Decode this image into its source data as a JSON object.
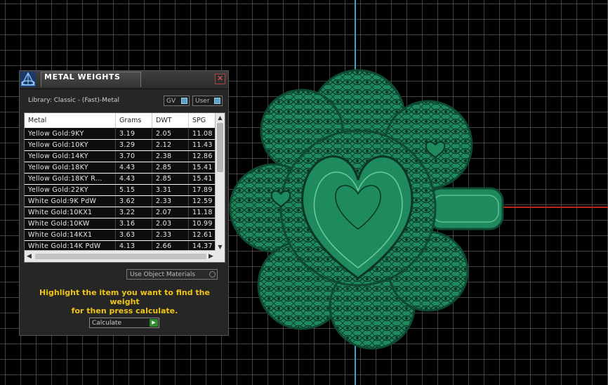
{
  "panel": {
    "title": "METAL WEIGHTS",
    "close_glyph": "✕",
    "library": "Library: Classic - (Fast)-Metal",
    "gv_label": "GV",
    "user_label": "User",
    "columns": [
      "Metal",
      "Grams",
      "DWT",
      "SPG"
    ],
    "rows": [
      [
        "Yellow Gold:9KY",
        "3.19",
        "2.05",
        "11.08"
      ],
      [
        "Yellow Gold:10KY",
        "3.29",
        "2.12",
        "11.43"
      ],
      [
        "Yellow Gold:14KY",
        "3.70",
        "2.38",
        "12.86"
      ],
      [
        "Yellow Gold:18KY",
        "4.43",
        "2.85",
        "15.41"
      ],
      [
        "Yellow Gold:18KY R...",
        "4.43",
        "2.85",
        "15.41"
      ],
      [
        "Yellow Gold:22KY",
        "5.15",
        "3.31",
        "17.89"
      ],
      [
        "White Gold:9K PdW",
        "3.62",
        "2.33",
        "12.59"
      ],
      [
        "White Gold:10KX1",
        "3.22",
        "2.07",
        "11.18"
      ],
      [
        "White Gold:10KW",
        "3.16",
        "2.03",
        "10.99"
      ],
      [
        "White Gold:14KX1",
        "3.63",
        "2.33",
        "12.61"
      ],
      [
        "White Gold:14K PdW",
        "4.13",
        "2.66",
        "14.37"
      ]
    ],
    "use_object_materials": "Use Object Materials",
    "hint_line1": "Highlight the item you want to find the weight",
    "hint_line2": "for then press calculate.",
    "calculate_label": "Calculate"
  },
  "colors": {
    "background": "#000000",
    "grid": "#787878",
    "axis_vertical": "#3aa7c9",
    "axis_horizontal": "#c0261b",
    "model": "#1f8a5e",
    "hint_text": "#f0c419"
  },
  "icons": {
    "logo": "app-logo-icon",
    "close": "close-icon",
    "scroll_up": "chevron-up-icon",
    "scroll_down": "chevron-down-icon",
    "scroll_left": "chevron-left-icon",
    "scroll_right": "chevron-right-icon",
    "go": "play-icon"
  }
}
